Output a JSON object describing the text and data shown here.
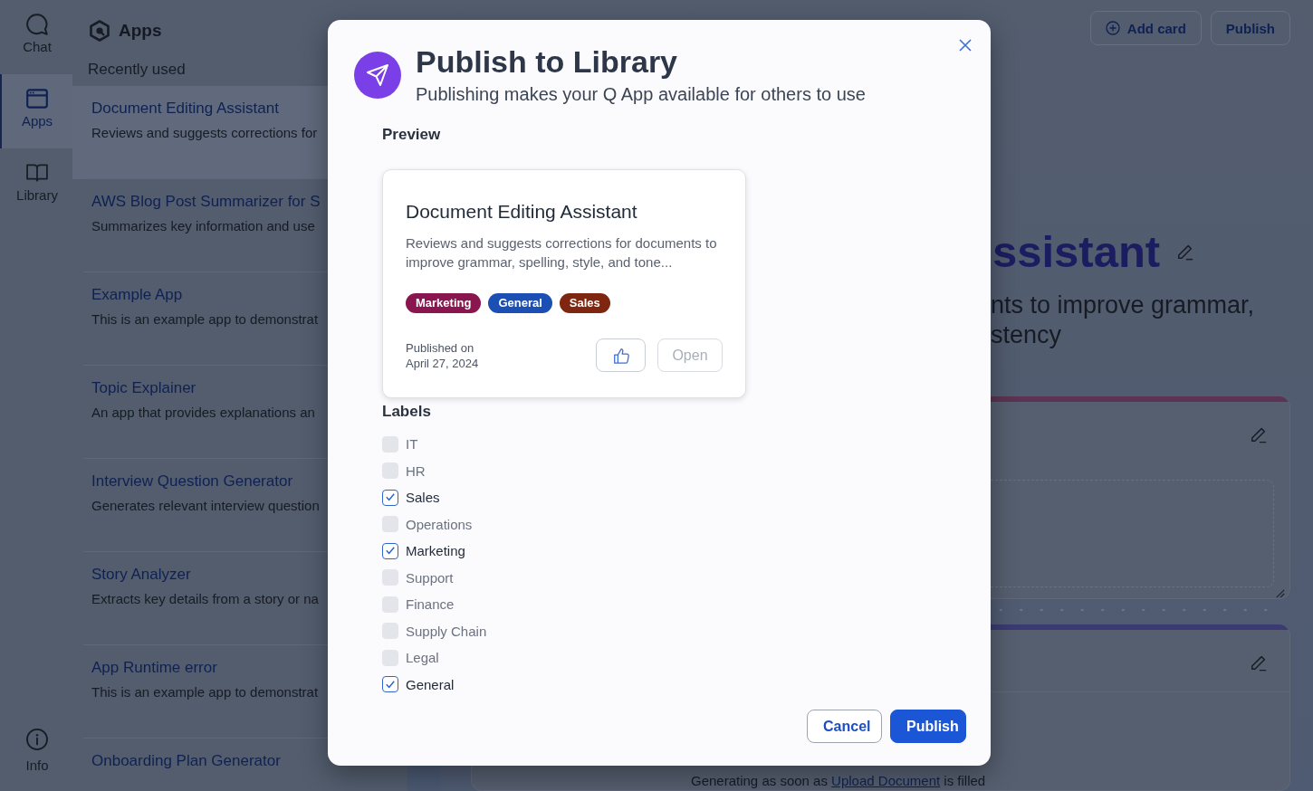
{
  "rail": {
    "items": [
      {
        "label": "Chat",
        "kind": "chat",
        "selected": false
      },
      {
        "label": "Apps",
        "kind": "apps",
        "selected": true
      },
      {
        "label": "Library",
        "kind": "library",
        "selected": false
      }
    ],
    "footer_item": {
      "label": "Info"
    }
  },
  "apps_panel": {
    "title": "Apps",
    "section_title": "Recently used",
    "items": [
      {
        "title": "Document Editing Assistant",
        "description": "Reviews and suggests corrections for",
        "selected": true
      },
      {
        "title": "AWS Blog Post Summarizer for S",
        "description": "Summarizes key information and use",
        "selected": false
      },
      {
        "title": "Example App",
        "description": "This is an example app to demonstrat",
        "selected": false
      },
      {
        "title": "Topic Explainer",
        "description": "An app that provides explanations an",
        "selected": false
      },
      {
        "title": "Interview Question Generator",
        "description": "Generates relevant interview question",
        "selected": false
      },
      {
        "title": "Story Analyzer",
        "description": "Extracts key details from a story or na",
        "selected": false
      },
      {
        "title": "App Runtime error",
        "description": "This is an example app to demonstrat",
        "selected": false
      },
      {
        "title": "Onboarding Plan Generator",
        "selected": false
      }
    ]
  },
  "toolbar": {
    "buttons": [
      {
        "label": "Add card",
        "kind": "add"
      },
      {
        "label": "Publish",
        "kind": "plain"
      }
    ]
  },
  "app_header": {
    "title_fragment": "ssistant",
    "description_lines": [
      "nts to improve grammar,",
      "stency"
    ]
  },
  "cards": [
    {
      "kind": "upload",
      "color": "#5c3352"
    },
    {
      "kind": "output",
      "color": "#3b3a73",
      "status": {
        "before": "Generating as soon as",
        "link": "Upload Document",
        "after": "is filled"
      }
    }
  ],
  "dialog": {
    "title": "Publish to Library",
    "subtitle": "Publishing makes your Q App available for others to use",
    "preview_heading": "Preview",
    "preview_card": {
      "title": "Document Editing Assistant",
      "description": "Reviews and suggests corrections for documents to improve grammar, spelling, style, and tone...",
      "tags": [
        {
          "label": "Marketing",
          "color": "#8a1650"
        },
        {
          "label": "General",
          "color": "#1c4fb3"
        },
        {
          "label": "Sales",
          "color": "#7e2610"
        }
      ],
      "published_label": "Published on",
      "published_date": "April 27, 2024",
      "open_button": {
        "label": "Open",
        "disabled": true
      }
    },
    "labels_heading": "Labels",
    "labels": [
      {
        "label": "IT",
        "checked": false,
        "disabled": true
      },
      {
        "label": "HR",
        "checked": false,
        "disabled": true
      },
      {
        "label": "Sales",
        "checked": true,
        "disabled": false
      },
      {
        "label": "Operations",
        "checked": false,
        "disabled": true
      },
      {
        "label": "Marketing",
        "checked": true,
        "disabled": false
      },
      {
        "label": "Support",
        "checked": false,
        "disabled": true
      },
      {
        "label": "Finance",
        "checked": false,
        "disabled": true
      },
      {
        "label": "Supply Chain",
        "checked": false,
        "disabled": true
      },
      {
        "label": "Legal",
        "checked": false,
        "disabled": true
      },
      {
        "label": "General",
        "checked": true,
        "disabled": false
      }
    ],
    "buttons": [
      {
        "label": "Cancel",
        "kind": "secondary"
      },
      {
        "label": "Publish",
        "kind": "primary"
      }
    ]
  }
}
